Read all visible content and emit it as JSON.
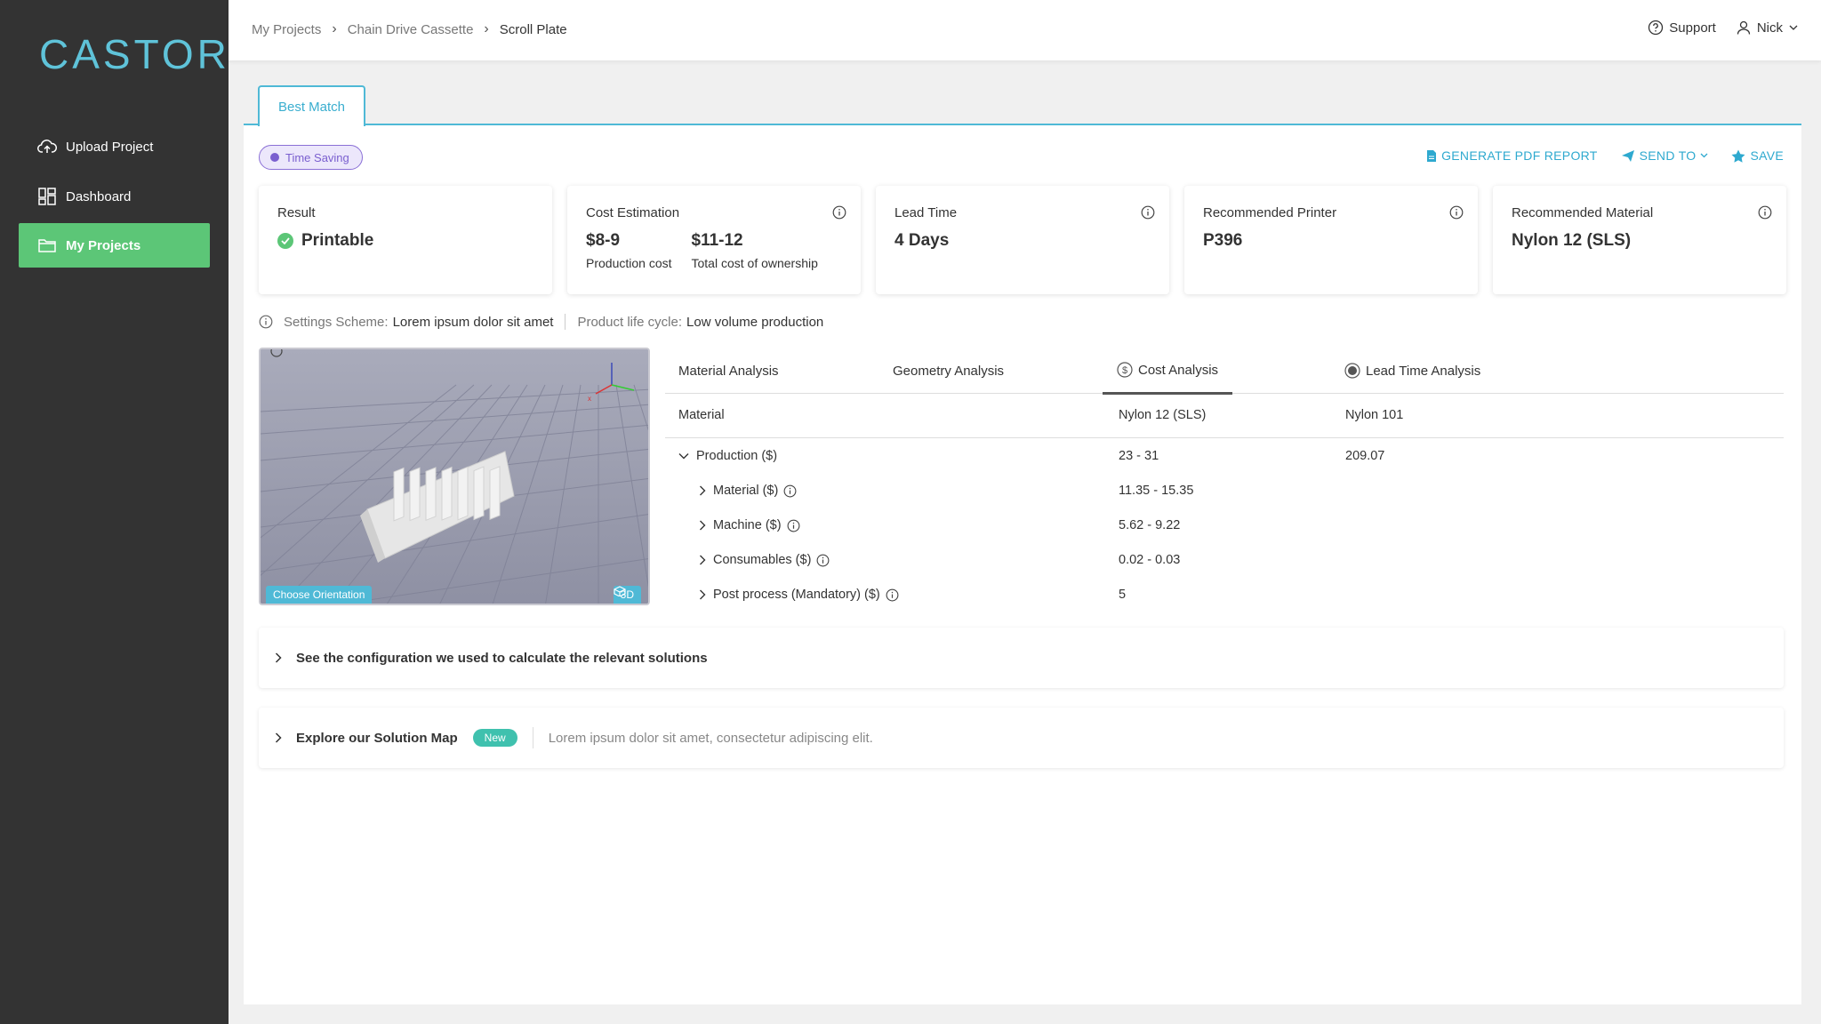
{
  "app": {
    "logo": "CASTOR"
  },
  "sidebar": {
    "items": [
      {
        "label": "Upload Project",
        "icon": "cloud-upload-icon"
      },
      {
        "label": "Dashboard",
        "icon": "dashboard-icon"
      },
      {
        "label": "My Projects",
        "icon": "folder-icon",
        "active": true
      }
    ]
  },
  "breadcrumb": {
    "items": [
      "My Projects",
      "Chain Drive Cassette",
      "Scroll Plate"
    ]
  },
  "header": {
    "support": "Support",
    "user": "Nick"
  },
  "main": {
    "tab": "Best Match",
    "badge": "Time Saving",
    "actions": {
      "pdf": "GENERATE PDF REPORT",
      "send": "SEND TO",
      "save": "SAVE"
    },
    "cards": {
      "result": {
        "title": "Result",
        "value": "Printable"
      },
      "cost": {
        "title": "Cost Estimation",
        "prod_value": "$8-9",
        "prod_label": "Production cost",
        "tco_value": "$11-12",
        "tco_label": "Total cost of ownership"
      },
      "lead": {
        "title": "Lead Time",
        "value": "4 Days"
      },
      "printer": {
        "title": "Recommended Printer",
        "value": "P396"
      },
      "material": {
        "title": "Recommended Material",
        "value": "Nylon 12 (SLS)"
      }
    },
    "settings": {
      "scheme_label": "Settings Scheme:",
      "scheme_value": "Lorem ipsum dolor sit amet",
      "lifecycle_label": "Product life cycle:",
      "lifecycle_value": "Low volume production"
    },
    "viewer": {
      "choose": "Choose Orientation",
      "view3d": "3D"
    },
    "analysis": {
      "tabs": [
        "Material Analysis",
        "Geometry Analysis",
        "Cost Analysis",
        "Lead Time Analysis"
      ],
      "header": {
        "label": "Material",
        "col1": "Nylon 12 (SLS)",
        "col2": "Nylon 101"
      },
      "rows": [
        {
          "label": "Production ($)",
          "col1": "23 - 31",
          "col2": "209.07"
        },
        {
          "label": "Material ($)",
          "col1": "11.35 - 15.35",
          "col2": ""
        },
        {
          "label": "Machine ($)",
          "col1": "5.62 - 9.22",
          "col2": ""
        },
        {
          "label": "Consumables ($)",
          "col1": "0.02 - 0.03",
          "col2": ""
        },
        {
          "label": "Post process (Mandatory) ($)",
          "col1": "5",
          "col2": ""
        }
      ]
    },
    "config": {
      "text": "See the configuration we used to calculate the relevant solutions"
    },
    "solution_map": {
      "text": "Explore our Solution Map",
      "badge": "New",
      "desc": "Lorem ipsum dolor sit amet, consectetur adipiscing elit."
    }
  },
  "colors": {
    "sidebar": "#333333",
    "active": "#5cc677",
    "accent": "#2ea9cf",
    "badge": "#7a5fcf",
    "new": "#3fc1ae"
  }
}
